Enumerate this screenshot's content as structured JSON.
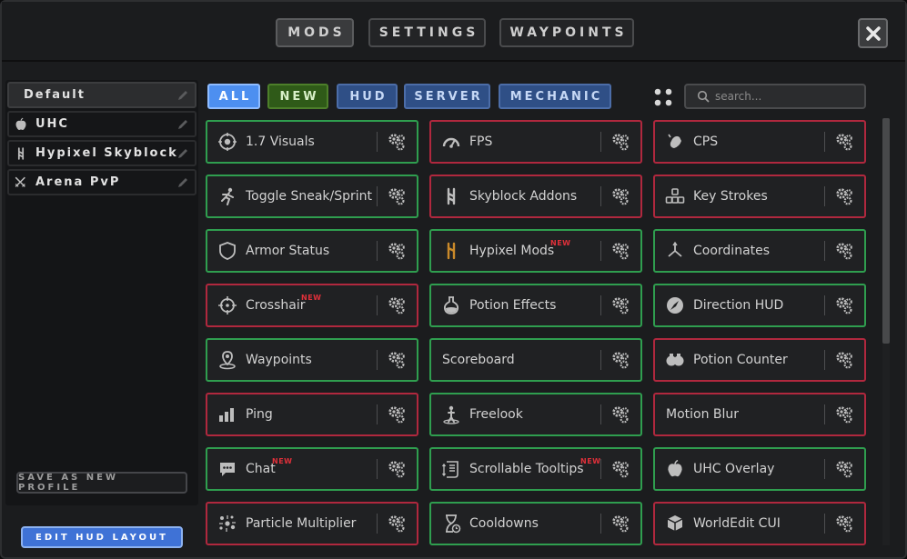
{
  "top_tabs": [
    {
      "label": "MODS",
      "active": true
    },
    {
      "label": "SETTINGS",
      "active": false
    },
    {
      "label": "WAYPOINTS",
      "active": false
    }
  ],
  "profiles": [
    {
      "label": "Default",
      "icon": "none",
      "active": true
    },
    {
      "label": "UHC",
      "icon": "apple-icon",
      "active": false
    },
    {
      "label": "Hypixel Skyblock",
      "icon": "skyblock-icon",
      "active": false
    },
    {
      "label": "Arena PvP",
      "icon": "crossed-swords-icon",
      "active": false
    }
  ],
  "sidebar": {
    "save_label": "SAVE AS NEW PROFILE",
    "edit_hud_label": "EDIT HUD LAYOUT"
  },
  "filters": [
    {
      "label": "ALL",
      "bg": "#4d8ff0",
      "border": "#8fbcff",
      "color": "#ffffff"
    },
    {
      "label": "NEW",
      "bg": "#2f5a18",
      "border": "#4d7f2a",
      "color": "#d8f0c8"
    },
    {
      "label": "HUD",
      "bg": "#2f4f86",
      "border": "#4c6da8",
      "color": "#c6d8f5"
    },
    {
      "label": "SERVER",
      "bg": "#2f4f86",
      "border": "#4c6da8",
      "color": "#c6d8f5"
    },
    {
      "label": "MECHANIC",
      "bg": "#2f4f86",
      "border": "#4c6da8",
      "color": "#c6d8f5"
    }
  ],
  "search": {
    "placeholder": "search..."
  },
  "new_tag": "NEW",
  "mods": [
    {
      "label": "1.7 Visuals",
      "icon": "eye-target-icon",
      "enabled": true,
      "new": false
    },
    {
      "label": "FPS",
      "icon": "speedometer-icon",
      "enabled": false,
      "new": false
    },
    {
      "label": "CPS",
      "icon": "mouse-icon",
      "enabled": false,
      "new": false
    },
    {
      "label": "Toggle Sneak/Sprint",
      "icon": "running-icon",
      "enabled": true,
      "new": false
    },
    {
      "label": "Skyblock Addons",
      "icon": "skyblock-icon",
      "enabled": false,
      "new": false
    },
    {
      "label": "Key Strokes",
      "icon": "keys-icon",
      "enabled": false,
      "new": false
    },
    {
      "label": "Armor Status",
      "icon": "shield-icon",
      "enabled": true,
      "new": false
    },
    {
      "label": "Hypixel Mods",
      "icon": "hypixel-icon",
      "enabled": true,
      "new": true
    },
    {
      "label": "Coordinates",
      "icon": "axes-icon",
      "enabled": true,
      "new": false
    },
    {
      "label": "Crosshair",
      "icon": "crosshair-icon",
      "enabled": false,
      "new": true
    },
    {
      "label": "Potion Effects",
      "icon": "potion-icon",
      "enabled": true,
      "new": false
    },
    {
      "label": "Direction HUD",
      "icon": "compass-icon",
      "enabled": true,
      "new": false
    },
    {
      "label": "Waypoints",
      "icon": "map-pin-icon",
      "enabled": true,
      "new": false
    },
    {
      "label": "Scoreboard",
      "icon": "none",
      "enabled": true,
      "new": false
    },
    {
      "label": "Potion Counter",
      "icon": "potions-icon",
      "enabled": false,
      "new": false
    },
    {
      "label": "Ping",
      "icon": "signal-bars-icon",
      "enabled": false,
      "new": false
    },
    {
      "label": "Freelook",
      "icon": "freelook-icon",
      "enabled": true,
      "new": false
    },
    {
      "label": "Motion Blur",
      "icon": "none",
      "enabled": false,
      "new": false
    },
    {
      "label": "Chat",
      "icon": "chat-bubble-icon",
      "enabled": true,
      "new": true
    },
    {
      "label": "Scrollable Tooltips",
      "icon": "scroll-icon",
      "enabled": true,
      "new": true
    },
    {
      "label": "UHC Overlay",
      "icon": "apple-icon",
      "enabled": true,
      "new": false
    },
    {
      "label": "Particle Multiplier",
      "icon": "particles-icon",
      "enabled": false,
      "new": false
    },
    {
      "label": "Cooldowns",
      "icon": "hourglass-icon",
      "enabled": true,
      "new": false
    },
    {
      "label": "WorldEdit CUI",
      "icon": "cube-icon",
      "enabled": false,
      "new": false
    }
  ]
}
